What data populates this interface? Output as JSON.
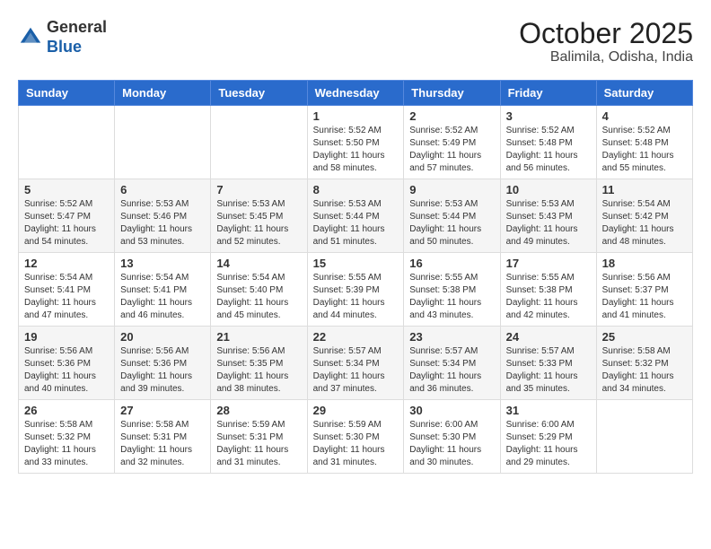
{
  "header": {
    "logo_line1": "General",
    "logo_line2": "Blue",
    "month": "October 2025",
    "location": "Balimila, Odisha, India"
  },
  "weekdays": [
    "Sunday",
    "Monday",
    "Tuesday",
    "Wednesday",
    "Thursday",
    "Friday",
    "Saturday"
  ],
  "weeks": [
    [
      {
        "day": "",
        "info": ""
      },
      {
        "day": "",
        "info": ""
      },
      {
        "day": "",
        "info": ""
      },
      {
        "day": "1",
        "info": "Sunrise: 5:52 AM\nSunset: 5:50 PM\nDaylight: 11 hours\nand 58 minutes."
      },
      {
        "day": "2",
        "info": "Sunrise: 5:52 AM\nSunset: 5:49 PM\nDaylight: 11 hours\nand 57 minutes."
      },
      {
        "day": "3",
        "info": "Sunrise: 5:52 AM\nSunset: 5:48 PM\nDaylight: 11 hours\nand 56 minutes."
      },
      {
        "day": "4",
        "info": "Sunrise: 5:52 AM\nSunset: 5:48 PM\nDaylight: 11 hours\nand 55 minutes."
      }
    ],
    [
      {
        "day": "5",
        "info": "Sunrise: 5:52 AM\nSunset: 5:47 PM\nDaylight: 11 hours\nand 54 minutes."
      },
      {
        "day": "6",
        "info": "Sunrise: 5:53 AM\nSunset: 5:46 PM\nDaylight: 11 hours\nand 53 minutes."
      },
      {
        "day": "7",
        "info": "Sunrise: 5:53 AM\nSunset: 5:45 PM\nDaylight: 11 hours\nand 52 minutes."
      },
      {
        "day": "8",
        "info": "Sunrise: 5:53 AM\nSunset: 5:44 PM\nDaylight: 11 hours\nand 51 minutes."
      },
      {
        "day": "9",
        "info": "Sunrise: 5:53 AM\nSunset: 5:44 PM\nDaylight: 11 hours\nand 50 minutes."
      },
      {
        "day": "10",
        "info": "Sunrise: 5:53 AM\nSunset: 5:43 PM\nDaylight: 11 hours\nand 49 minutes."
      },
      {
        "day": "11",
        "info": "Sunrise: 5:54 AM\nSunset: 5:42 PM\nDaylight: 11 hours\nand 48 minutes."
      }
    ],
    [
      {
        "day": "12",
        "info": "Sunrise: 5:54 AM\nSunset: 5:41 PM\nDaylight: 11 hours\nand 47 minutes."
      },
      {
        "day": "13",
        "info": "Sunrise: 5:54 AM\nSunset: 5:41 PM\nDaylight: 11 hours\nand 46 minutes."
      },
      {
        "day": "14",
        "info": "Sunrise: 5:54 AM\nSunset: 5:40 PM\nDaylight: 11 hours\nand 45 minutes."
      },
      {
        "day": "15",
        "info": "Sunrise: 5:55 AM\nSunset: 5:39 PM\nDaylight: 11 hours\nand 44 minutes."
      },
      {
        "day": "16",
        "info": "Sunrise: 5:55 AM\nSunset: 5:38 PM\nDaylight: 11 hours\nand 43 minutes."
      },
      {
        "day": "17",
        "info": "Sunrise: 5:55 AM\nSunset: 5:38 PM\nDaylight: 11 hours\nand 42 minutes."
      },
      {
        "day": "18",
        "info": "Sunrise: 5:56 AM\nSunset: 5:37 PM\nDaylight: 11 hours\nand 41 minutes."
      }
    ],
    [
      {
        "day": "19",
        "info": "Sunrise: 5:56 AM\nSunset: 5:36 PM\nDaylight: 11 hours\nand 40 minutes."
      },
      {
        "day": "20",
        "info": "Sunrise: 5:56 AM\nSunset: 5:36 PM\nDaylight: 11 hours\nand 39 minutes."
      },
      {
        "day": "21",
        "info": "Sunrise: 5:56 AM\nSunset: 5:35 PM\nDaylight: 11 hours\nand 38 minutes."
      },
      {
        "day": "22",
        "info": "Sunrise: 5:57 AM\nSunset: 5:34 PM\nDaylight: 11 hours\nand 37 minutes."
      },
      {
        "day": "23",
        "info": "Sunrise: 5:57 AM\nSunset: 5:34 PM\nDaylight: 11 hours\nand 36 minutes."
      },
      {
        "day": "24",
        "info": "Sunrise: 5:57 AM\nSunset: 5:33 PM\nDaylight: 11 hours\nand 35 minutes."
      },
      {
        "day": "25",
        "info": "Sunrise: 5:58 AM\nSunset: 5:32 PM\nDaylight: 11 hours\nand 34 minutes."
      }
    ],
    [
      {
        "day": "26",
        "info": "Sunrise: 5:58 AM\nSunset: 5:32 PM\nDaylight: 11 hours\nand 33 minutes."
      },
      {
        "day": "27",
        "info": "Sunrise: 5:58 AM\nSunset: 5:31 PM\nDaylight: 11 hours\nand 32 minutes."
      },
      {
        "day": "28",
        "info": "Sunrise: 5:59 AM\nSunset: 5:31 PM\nDaylight: 11 hours\nand 31 minutes."
      },
      {
        "day": "29",
        "info": "Sunrise: 5:59 AM\nSunset: 5:30 PM\nDaylight: 11 hours\nand 31 minutes."
      },
      {
        "day": "30",
        "info": "Sunrise: 6:00 AM\nSunset: 5:30 PM\nDaylight: 11 hours\nand 30 minutes."
      },
      {
        "day": "31",
        "info": "Sunrise: 6:00 AM\nSunset: 5:29 PM\nDaylight: 11 hours\nand 29 minutes."
      },
      {
        "day": "",
        "info": ""
      }
    ]
  ]
}
